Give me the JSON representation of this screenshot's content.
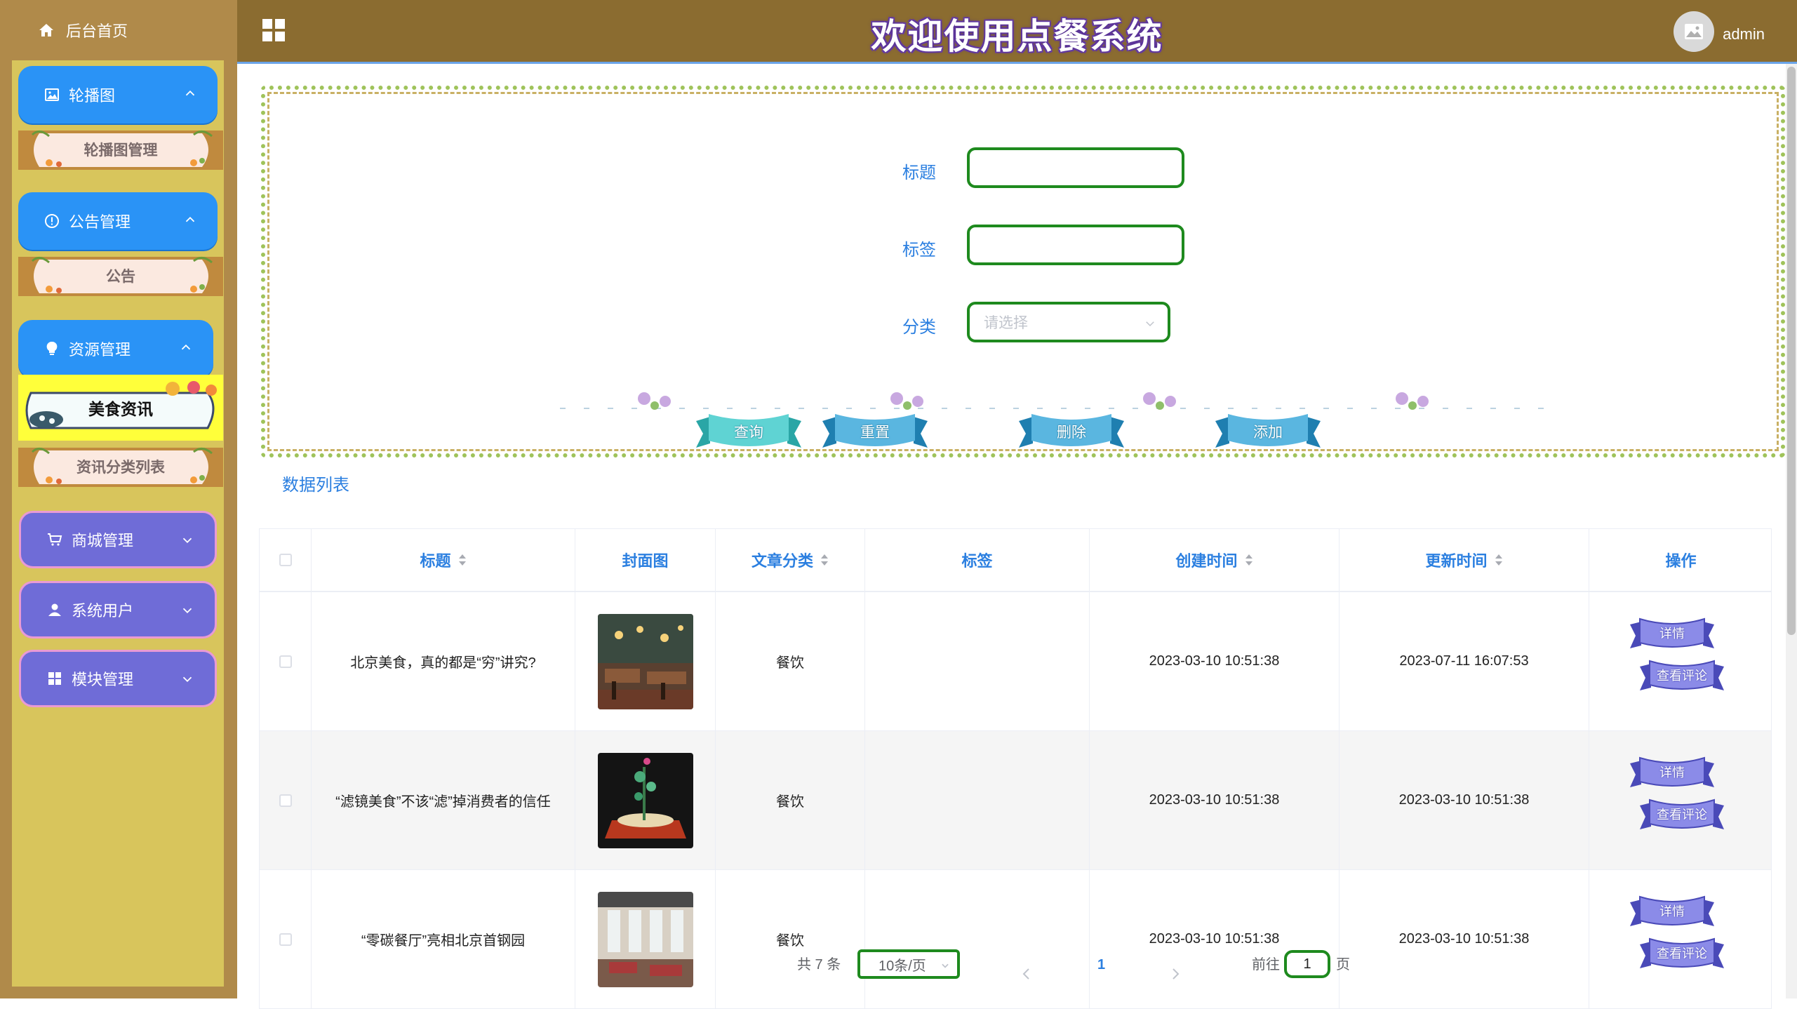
{
  "header": {
    "title": "欢迎使用点餐系统",
    "username": "admin"
  },
  "sidebar": {
    "home_label": "后台首页",
    "menus": [
      {
        "label": "轮播图",
        "icon": "picture-icon",
        "expanded": true,
        "sub": [
          "轮播图管理"
        ]
      },
      {
        "label": "公告管理",
        "icon": "info-circle-icon",
        "expanded": true,
        "sub": [
          "公告"
        ]
      },
      {
        "label": "资源管理",
        "icon": "lightbulb-icon",
        "expanded": true,
        "sub": [
          "美食资讯",
          "资讯分类列表"
        ]
      },
      {
        "label": "商城管理",
        "icon": "cart-icon",
        "expanded": false
      },
      {
        "label": "系统用户",
        "icon": "user-icon",
        "expanded": false
      },
      {
        "label": "模块管理",
        "icon": "grid-icon",
        "expanded": false
      }
    ],
    "active_item": "美食资讯"
  },
  "search_form": {
    "title_label": "标题",
    "tag_label": "标签",
    "category_label": "分类",
    "category_placeholder": "请选择",
    "buttons": {
      "query": "查询",
      "reset": "重置",
      "delete": "删除",
      "add": "添加"
    }
  },
  "data_list_title": "数据列表",
  "table": {
    "columns": [
      "标题",
      "封面图",
      "文章分类",
      "标签",
      "创建时间",
      "更新时间",
      "操作"
    ],
    "rows": [
      {
        "title": "北京美食，真的都是“穷”讲究?",
        "category": "餐饮",
        "tag": "",
        "created": "2023-03-10 10:51:38",
        "updated": "2023-07-11 16:07:53"
      },
      {
        "title": "“滤镜美食”不该“滤”掉消费者的信任",
        "category": "餐饮",
        "tag": "",
        "created": "2023-03-10 10:51:38",
        "updated": "2023-03-10 10:51:38"
      },
      {
        "title": "“零碳餐厅”亮相北京首钢园",
        "category": "餐饮",
        "tag": "",
        "created": "2023-03-10 10:51:38",
        "updated": "2023-03-10 10:51:38"
      }
    ],
    "row_actions": {
      "detail": "详情",
      "comments": "查看评论"
    }
  },
  "pagination": {
    "total_text": "共 7 条",
    "page_size": "10条/页",
    "current_page": "1",
    "goto_prefix": "前往",
    "goto_value": "1",
    "goto_suffix": "页"
  },
  "colors": {
    "sidebar_bg": "#b08a4a",
    "menu_panel_bg": "#d8c55c",
    "header_bg": "#8b6c30",
    "menu_blue": "#2a93f6",
    "menu_purple": "#6f6cd7",
    "accent_text": "#2b7fe0",
    "input_border": "#1e8a1e"
  }
}
